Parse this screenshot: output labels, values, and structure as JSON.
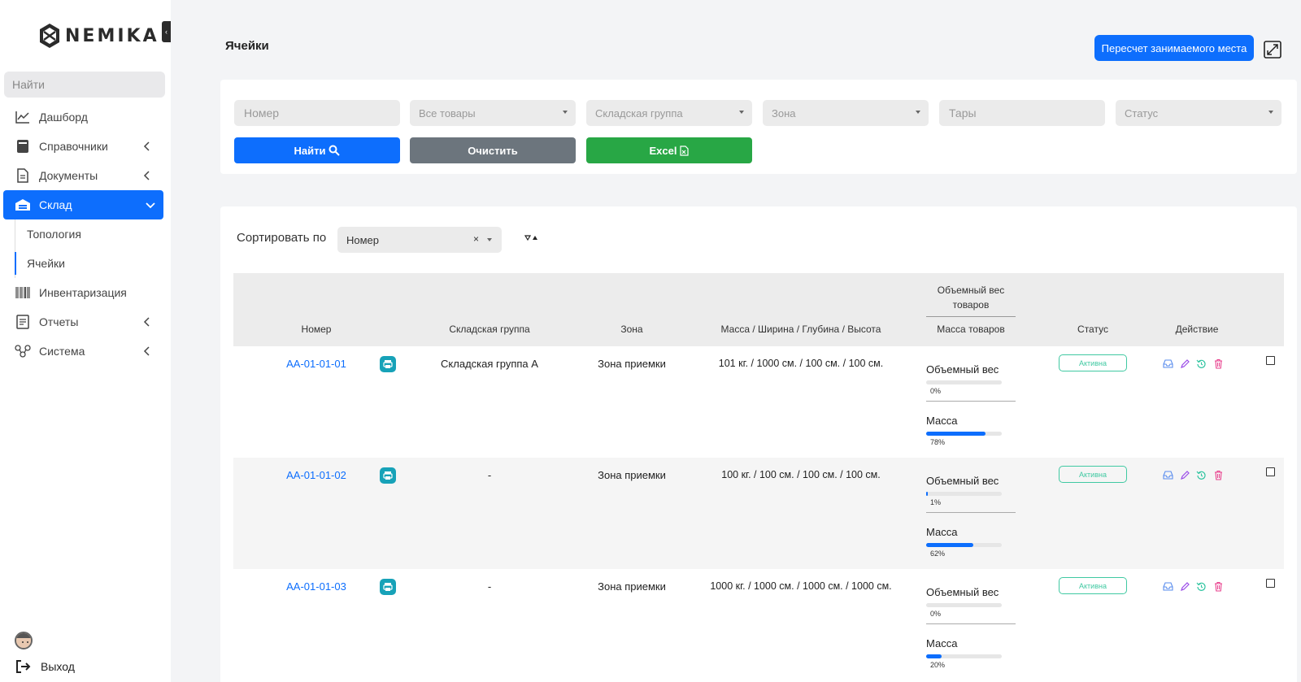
{
  "app": {
    "logo_text": "NEMIKA"
  },
  "sidebar": {
    "search_placeholder": "Найти",
    "items": [
      {
        "label": "Дашборд",
        "icon": "chart-line-icon",
        "has_chevron": false
      },
      {
        "label": "Справочники",
        "icon": "book-icon",
        "has_chevron": true
      },
      {
        "label": "Документы",
        "icon": "document-icon",
        "has_chevron": true
      },
      {
        "label": "Склад",
        "icon": "warehouse-icon",
        "has_chevron": true,
        "active": true
      },
      {
        "label": "Инвентаризация",
        "icon": "barcode-icon",
        "has_chevron": false
      },
      {
        "label": "Отчеты",
        "icon": "report-icon",
        "has_chevron": true
      },
      {
        "label": "Система",
        "icon": "nodes-icon",
        "has_chevron": true
      }
    ],
    "sub_items": [
      {
        "label": "Топология"
      },
      {
        "label": "Ячейки",
        "current": true
      }
    ],
    "logout_label": "Выход"
  },
  "header": {
    "title": "Ячейки",
    "recalc_label": "Пересчет занимаемого места"
  },
  "filters": {
    "number_placeholder": "Номер",
    "goods_placeholder": "Все товары",
    "group_placeholder": "Складская группа",
    "zone_placeholder": "Зона",
    "tare_placeholder": "Тары",
    "status_placeholder": "Статус",
    "find_label": "Найти",
    "clear_label": "Очистить",
    "excel_label": "Excel"
  },
  "sort": {
    "label": "Сортировать по",
    "value": "Номер",
    "clear_symbol": "×"
  },
  "table": {
    "headers": {
      "number": "Номер",
      "group": "Складская группа",
      "zone": "Зона",
      "dims": "Масса / Ширина / Глубина / Высота",
      "volume_weight": "Объемный вес товаров",
      "goods_mass": "Масса товаров",
      "status": "Статус",
      "action": "Действие"
    },
    "metric_labels": {
      "volume": "Объемный вес",
      "mass": "Масса"
    },
    "rows": [
      {
        "number": "AA-01-01-01",
        "group": "Складская группа А",
        "zone": "Зона приемки",
        "dims": "101 кг. / 1000 см. / 100 см. / 100 см.",
        "volume_pct": "0%",
        "volume": 0,
        "mass_pct": "78%",
        "mass": 0.78,
        "status": "Активна"
      },
      {
        "number": "AA-01-01-02",
        "group": "-",
        "zone": "Зона приемки",
        "dims": "100 кг. / 100 см. / 100 см. / 100 см.",
        "volume_pct": "1%",
        "volume": 0.01,
        "mass_pct": "62%",
        "mass": 0.62,
        "status": "Активна"
      },
      {
        "number": "AA-01-01-03",
        "group": "-",
        "zone": "Зона приемки",
        "dims": "1000 кг. / 1000 см. / 1000 см. / 1000 см.",
        "volume_pct": "0%",
        "volume": 0,
        "mass_pct": "20%",
        "mass": 0.2,
        "status": "Активна"
      }
    ]
  },
  "colors": {
    "primary": "#0d6efd",
    "secondary": "#6c757d",
    "success": "#28a745",
    "info": "#17a2b8",
    "badge": "#40c9a2"
  }
}
